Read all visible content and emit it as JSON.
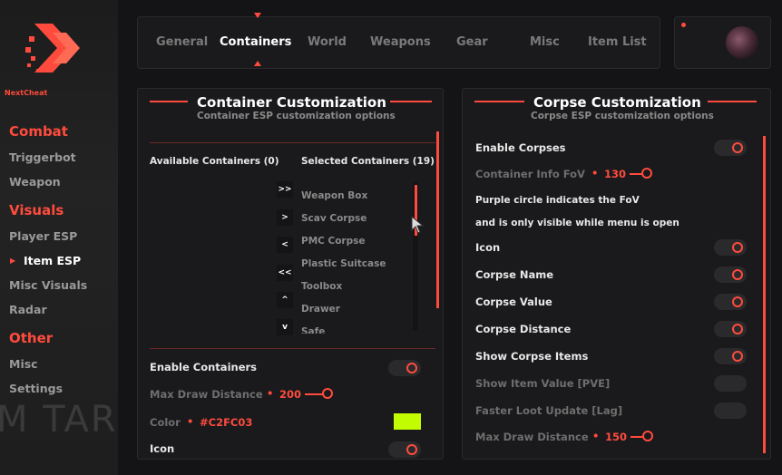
{
  "brand": {
    "name": "NextCheat",
    "accent": "#FF4B3E",
    "bg_text": "M TAR"
  },
  "sidebar": {
    "sections": [
      {
        "label": "Combat",
        "items": [
          "Triggerbot",
          "Weapon"
        ]
      },
      {
        "label": "Visuals",
        "items": [
          "Player ESP",
          "Item ESP",
          "Misc Visuals",
          "Radar"
        ]
      },
      {
        "label": "Other",
        "items": [
          "Misc",
          "Settings"
        ]
      }
    ],
    "active_item": "Item ESP"
  },
  "tabs": [
    "General",
    "Containers",
    "World",
    "Weapons",
    "Gear",
    "Misc",
    "Item List"
  ],
  "active_tab": "Containers",
  "container_panel": {
    "title": "Container Customization",
    "subtitle": "Container ESP customization options",
    "available_header": "Available Containers (0)",
    "selected_header": "Selected Containers (19)",
    "buttons": [
      ">>",
      ">",
      "<",
      "<<",
      "^",
      "v"
    ],
    "selected_items": [
      "Weapon Box",
      "Scav Corpse",
      "PMC Corpse",
      "Plastic Suitcase",
      "Toolbox",
      "Drawer",
      "Safe"
    ],
    "enable_label": "Enable Containers",
    "max_draw_label": "Max Draw Distance",
    "max_draw_value": "200",
    "max_draw_fraction": 0.55,
    "color_label": "Color",
    "color_value": "#C2FC03",
    "icon_label": "Icon"
  },
  "corpse_panel": {
    "title": "Corpse Customization",
    "subtitle": "Corpse ESP customization options",
    "enable_label": "Enable Corpses",
    "fov_label": "Container Info FoV",
    "fov_value": "130",
    "fov_fraction": 0.45,
    "info_line1": "Purple circle indicates the FoV",
    "info_line2": "and is only visible while menu is open",
    "icon_label": "Icon",
    "name_label": "Corpse Name",
    "value_label": "Corpse Value",
    "distance_label": "Corpse Distance",
    "items_label": "Show Corpse Items",
    "item_value_label": "Show Item Value [PVE]",
    "faster_loot_label": "Faster Loot Update [Lag]",
    "max_draw_label": "Max Draw Distance",
    "max_draw_value": "150",
    "max_draw_fraction": 0.4
  }
}
